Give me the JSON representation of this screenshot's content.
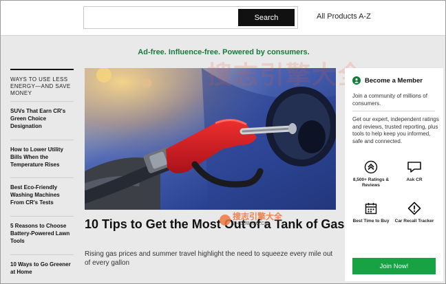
{
  "header": {
    "search_placeholder": "",
    "search_button_label": "Search",
    "all_products_label": "All Products A-Z"
  },
  "tagline": "Ad-free. Influence-free. Powered by consumers.",
  "sidebar": {
    "heading": "WAYS TO USE LESS ENERGY—AND SAVE MONEY",
    "items": [
      {
        "label": "SUVs That Earn CR's Green Choice Designation"
      },
      {
        "label": "How to Lower Utility Bills When the Temperature Rises"
      },
      {
        "label": "Best Eco-Friendly Washing Machines From CR's Tests"
      },
      {
        "label": "5 Reasons to Choose Battery-Powered Lawn Tools"
      },
      {
        "label": "10 Ways to Go Greener at Home"
      }
    ]
  },
  "article": {
    "title": "10 Tips to Get the Most Out of a Tank of Gas",
    "dek": "Rising gas prices and summer travel highlight the need to squeeze every mile out of every gallon"
  },
  "member": {
    "title": "Become a Member",
    "intro": "Join a community of millions of consumers.",
    "description": "Get our expert, independent ratings and reviews, trusted reporting, plus tools to help keep you informed, safe and connected.",
    "benefits": [
      {
        "label": "8,500+ Ratings & Reviews",
        "icon": "ratings-chevron-icon"
      },
      {
        "label": "Ask CR",
        "icon": "chat-bubble-icon"
      },
      {
        "label": "Best Time to Buy",
        "icon": "calendar-icon"
      },
      {
        "label": "Car Recall Tracker",
        "icon": "warning-diamond-icon"
      }
    ],
    "join_label": "Join Now!"
  },
  "watermark": {
    "large_text": "搜志引擎大全",
    "small_name": "搜志引擎大全",
    "small_url": "ZHOUBLOG.CN"
  },
  "colors": {
    "accent_green": "#157a3b",
    "button_green": "#17a243",
    "search_button": "#111111",
    "page_bg": "#e9e9e9"
  }
}
